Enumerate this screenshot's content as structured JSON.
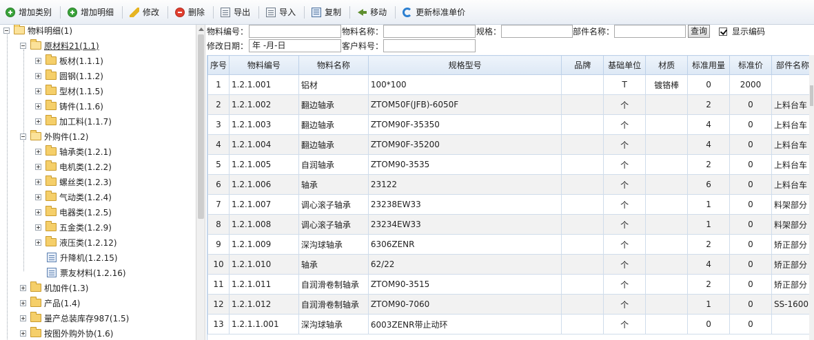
{
  "toolbar": {
    "buttons": [
      {
        "label": "增加类别",
        "icon": "add-icon"
      },
      {
        "label": "增加明细",
        "icon": "add-icon"
      },
      {
        "label": "修改",
        "icon": "edit-icon"
      },
      {
        "label": "删除",
        "icon": "delete-icon"
      },
      {
        "label": "导出",
        "icon": "export-icon"
      },
      {
        "label": "导入",
        "icon": "import-icon"
      },
      {
        "label": "复制",
        "icon": "copy-icon"
      },
      {
        "label": "移动",
        "icon": "move-icon"
      },
      {
        "label": "更新标准单价",
        "icon": "refresh-icon"
      }
    ]
  },
  "tree": {
    "root": "物料明细(1)",
    "nodes": [
      {
        "label": "原材料21(1.1)",
        "selected": true
      },
      {
        "label": "板材(1.1.1)"
      },
      {
        "label": "圆钢(1.1.2)"
      },
      {
        "label": "型材(1.1.5)"
      },
      {
        "label": "铸件(1.1.6)"
      },
      {
        "label": "加工料(1.1.7)"
      },
      {
        "label": "外购件(1.2)"
      },
      {
        "label": "轴承类(1.2.1)"
      },
      {
        "label": "电机类(1.2.2)"
      },
      {
        "label": "螺丝类(1.2.3)"
      },
      {
        "label": "气动类(1.2.4)"
      },
      {
        "label": "电器类(1.2.5)"
      },
      {
        "label": "五金类(1.2.9)"
      },
      {
        "label": "液压类(1.2.12)"
      },
      {
        "label": "升降机(1.2.15)"
      },
      {
        "label": "票友材料(1.2.16)"
      },
      {
        "label": "机加件(1.3)"
      },
      {
        "label": "产品(1.4)"
      },
      {
        "label": "量产总装库存987(1.5)"
      },
      {
        "label": "按图外购外协(1.6)"
      }
    ]
  },
  "search": {
    "material_code_label": "物料编号：",
    "material_name_label": "物料名称：",
    "spec_label": "规格：",
    "part_name_label": "部件名称：",
    "query_button": "查询",
    "show_code_label": "显示编码",
    "show_code_checked": true,
    "modify_date_label": "修改日期：",
    "modify_date_value": "年 -月-日",
    "customer_code_label": "客户料号："
  },
  "grid": {
    "columns": [
      "序号",
      "物料编号",
      "物料名称",
      "规格型号",
      "品牌",
      "基础单位",
      "材质",
      "标准用量",
      "标准价",
      "部件名称"
    ],
    "rows": [
      [
        "1",
        "1.2.1.001",
        "铝材",
        "100*100",
        "",
        "T",
        "镀铬棒",
        "0",
        "2000",
        ""
      ],
      [
        "2",
        "1.2.1.002",
        "翻边轴承",
        "ZTOM50F(JFB)-6050F",
        "",
        "个",
        "",
        "2",
        "0",
        "上料台车"
      ],
      [
        "3",
        "1.2.1.003",
        "翻边轴承",
        "ZTOM90F-35350",
        "",
        "个",
        "",
        "4",
        "0",
        "上料台车"
      ],
      [
        "4",
        "1.2.1.004",
        "翻边轴承",
        "ZTOM90F-35200",
        "",
        "个",
        "",
        "4",
        "0",
        "上料台车"
      ],
      [
        "5",
        "1.2.1.005",
        "自润轴承",
        "ZTOM90-3535",
        "",
        "个",
        "",
        "2",
        "0",
        "上料台车"
      ],
      [
        "6",
        "1.2.1.006",
        "轴承",
        "23122",
        "",
        "个",
        "",
        "6",
        "0",
        "上料台车"
      ],
      [
        "7",
        "1.2.1.007",
        "调心滚子轴承",
        "23238EW33",
        "",
        "个",
        "",
        "1",
        "0",
        "料架部分"
      ],
      [
        "8",
        "1.2.1.008",
        "调心滚子轴承",
        "23234EW33",
        "",
        "个",
        "",
        "1",
        "0",
        "料架部分"
      ],
      [
        "9",
        "1.2.1.009",
        "深沟球轴承",
        "6306ZENR",
        "",
        "个",
        "",
        "2",
        "0",
        "矫正部分"
      ],
      [
        "10",
        "1.2.1.010",
        "轴承",
        "62/22",
        "",
        "个",
        "",
        "4",
        "0",
        "矫正部分"
      ],
      [
        "11",
        "1.2.1.011",
        "自润滑卷制轴承",
        "ZTOM90-3515",
        "",
        "个",
        "",
        "2",
        "0",
        "矫正部分"
      ],
      [
        "12",
        "1.2.1.012",
        "自润滑卷制轴承",
        "ZTOM90-7060",
        "",
        "个",
        "",
        "1",
        "0",
        "SS-1600"
      ],
      [
        "13",
        "1.2.1.1.001",
        "深沟球轴承",
        "6003ZENR带止动环",
        "",
        "个",
        "",
        "0",
        "0",
        ""
      ]
    ]
  }
}
